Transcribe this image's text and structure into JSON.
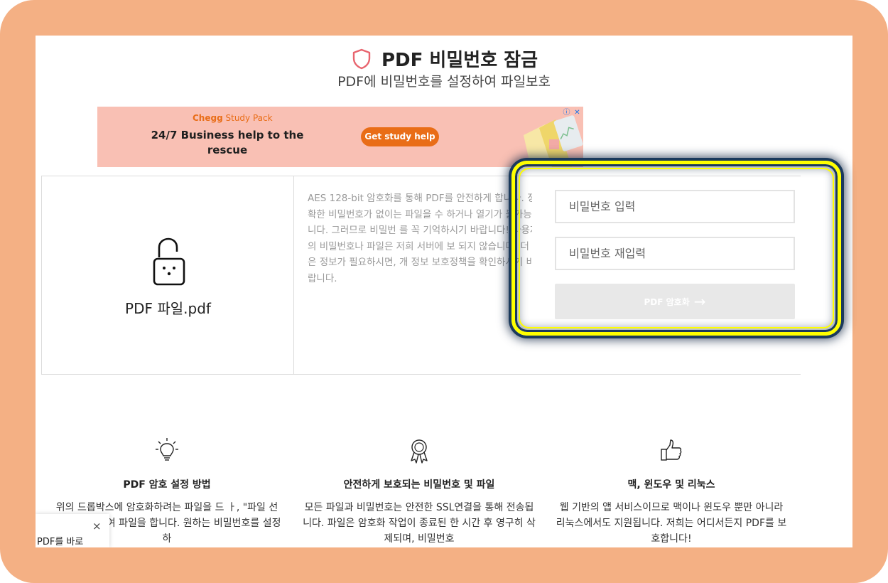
{
  "header": {
    "title": "PDF 비밀번호 잠금",
    "subtitle": "PDF에 비밀번호를 설정하여 파일보호"
  },
  "ad": {
    "brand": "Chegg",
    "product": "Study Pack",
    "headline": "24/7 Business help to the rescue",
    "cta": "Get study help"
  },
  "tool": {
    "file_name": "PDF 파일.pdf",
    "description": "AES 128-bit 암호화를 통해 PDF를 안전하게 합니다. 정확한 비밀번호가 없이는 파일을 수 하거나 열기가 불가능합니다. 그러므로 비밀번 를 꼭 기억하시기 바랍니다! 사용자의 비밀번호나 파일은 저희 서버에 보 되지 않습니다. 더 많은 정보가 필요하시면, 개 정보 보호정책을 확인하시기 바랍니다.",
    "password_placeholder": "비밀번호 입력",
    "password_confirm_placeholder": "비밀번호 재입력",
    "encrypt_button": "PDF 암호화"
  },
  "features": [
    {
      "icon": "lightbulb-icon",
      "title": "PDF 암호 설정 방법",
      "text": "위의 드롭박스에 암호화하려는 파일을 드 ㅏ, \"파일 선택\"을 클릭하여 파일을 합니다. 원하는 비밀번호를 설정하"
    },
    {
      "icon": "award-ribbon-icon",
      "title": "안전하게 보호되는 비밀번호 및 파일",
      "text": "모든 파일과 비밀번호는 안전한 SSL연결을 통해 전송됩니다. 파일은 암호화 작업이 종료된 한 시간 후 영구히 삭제되며, 비밀번호"
    },
    {
      "icon": "thumbs-up-icon",
      "title": "맥, 윈도우 및 리눅스",
      "text": "웹 기반의 앱 서비스이므로 맥이나 윈도우 뿐만 아니라 리눅스에서도 지원됩니다. 저희는 어디서든지 PDF를 보호합니다!"
    }
  ],
  "toast": {
    "text": "PDF를 바로",
    "close": "×"
  },
  "colors": {
    "frame": "#f4b084",
    "accent": "#e96d17",
    "highlight": "#ffff00"
  }
}
